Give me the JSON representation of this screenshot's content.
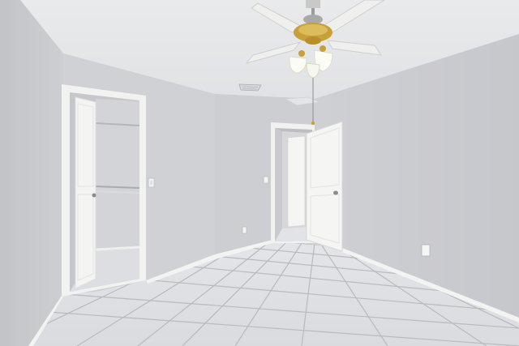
{
  "scene": {
    "kind": "photo",
    "subject": "empty-bedroom-interior",
    "colors": {
      "ceiling": "#e6e7ea",
      "wall_left": "#c9cacd",
      "wall_back": "#d2d3d6",
      "wall_right": "#cbccd1",
      "floor_tile": "#dfe1e4",
      "grout": "#b9bbbf",
      "trim": "#f4f4f3",
      "door": "#f2f2f1",
      "fan_brass": "#c9a23a",
      "fan_blade": "#eeeeec",
      "light_glass": "#fbfbf6"
    },
    "icons": [
      "ceiling-fan-icon",
      "door-knob-icon",
      "light-switch-icon",
      "outlet-icon",
      "air-vent-icon"
    ]
  }
}
